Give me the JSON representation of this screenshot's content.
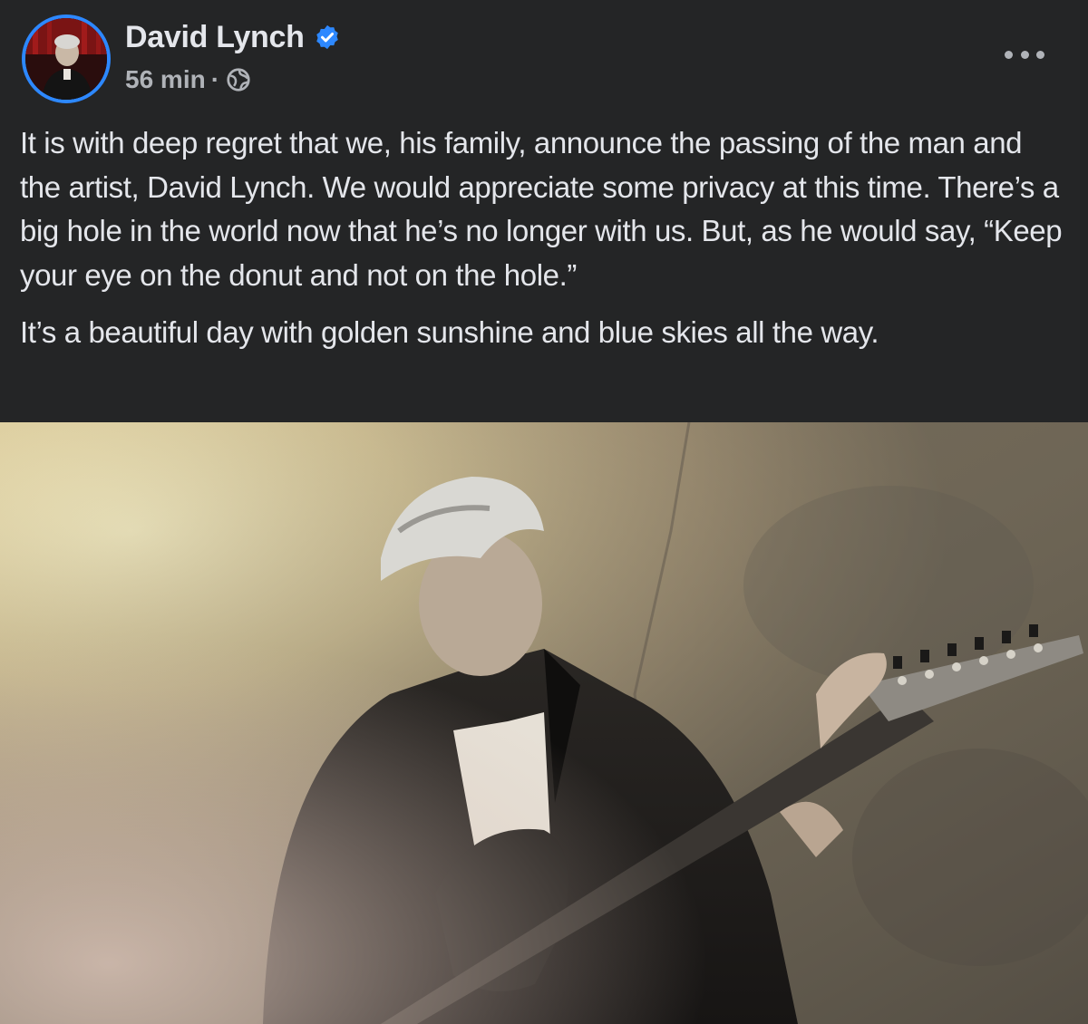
{
  "post": {
    "author": "David Lynch",
    "timestamp": "56 min",
    "separator": "·",
    "paragraphs": [
      "It is with deep regret that we, his family, announce the passing of the man and the artist, David Lynch.  We would appreciate some privacy at this time.  There’s a big hole in the world now that he’s no longer with us.  But, as he would say, “Keep your eye on the donut and not on the hole.”",
      "It’s a beautiful day with golden sunshine and blue skies all the way."
    ],
    "icons": {
      "verified": "verified-badge-icon",
      "audience": "globe-icon",
      "more": "more-options-icon"
    },
    "colors": {
      "background": "#242526",
      "text": "#e4e6eb",
      "secondary": "#b0b3b8",
      "accent": "#2d88ff"
    }
  }
}
